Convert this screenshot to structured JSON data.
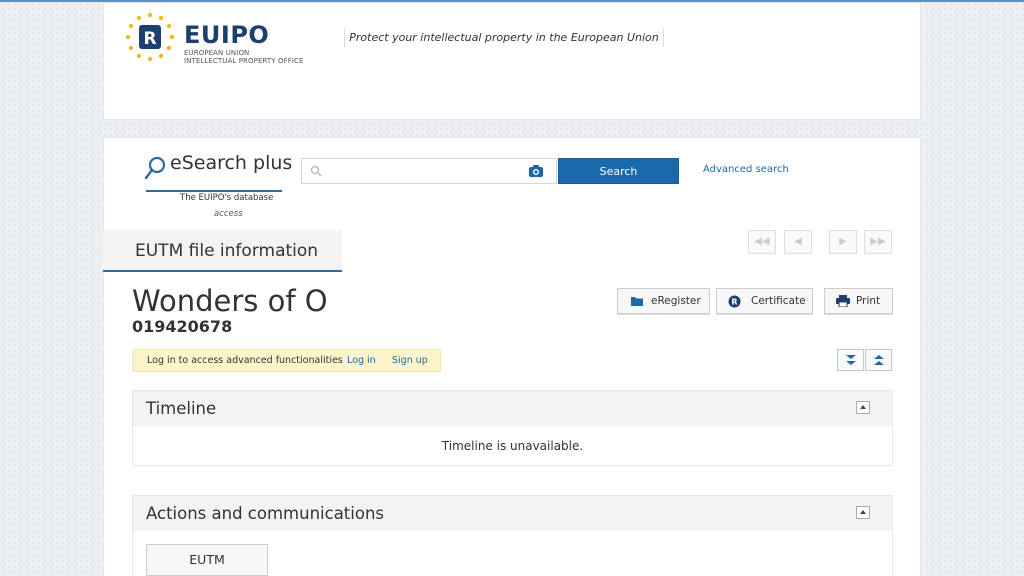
{
  "header": {
    "logo_word_eu": "EU",
    "logo_word_ipo": "IPO",
    "logo_sub1": "EUROPEAN UNION",
    "logo_sub2": "INTELLECTUAL PROPERTY OFFICE",
    "tagline": "Protect your intellectual property in the European Union"
  },
  "esearch": {
    "title": "eSearch plus",
    "subtitle_line1": "The EUIPO's database",
    "subtitle_line2": "access",
    "search_placeholder": "",
    "search_button": "Search",
    "advanced_link": "Advanced search"
  },
  "tab": {
    "label": "EUTM file information"
  },
  "pager": {
    "first": "◀◀",
    "prev": "◀",
    "next": "▶",
    "last": "▶▶"
  },
  "trademark": {
    "name": "Wonders of O",
    "number": "019420678"
  },
  "actions": {
    "eregister": "eRegister",
    "certificate": "Certificate",
    "print": "Print"
  },
  "login_bar": {
    "message": "Log in to access advanced functionalities",
    "login": "Log in",
    "signup": "Sign up"
  },
  "sections": {
    "timeline": {
      "title": "Timeline",
      "message": "Timeline is unavailable."
    },
    "actions": {
      "title": "Actions and communications",
      "eutm_button": "EUTM"
    }
  },
  "colors": {
    "brand_blue": "#1a6aab",
    "logo_navy": "#1d3f6e",
    "notice_yellow": "#fbf5c9"
  },
  "icons": {
    "search": "magnifier-icon",
    "camera": "camera-icon",
    "eregister": "folder-icon",
    "certificate": "registered-icon",
    "print": "printer-icon",
    "expand_all": "double-chevron-down-icon",
    "collapse_all": "double-chevron-up-icon"
  }
}
